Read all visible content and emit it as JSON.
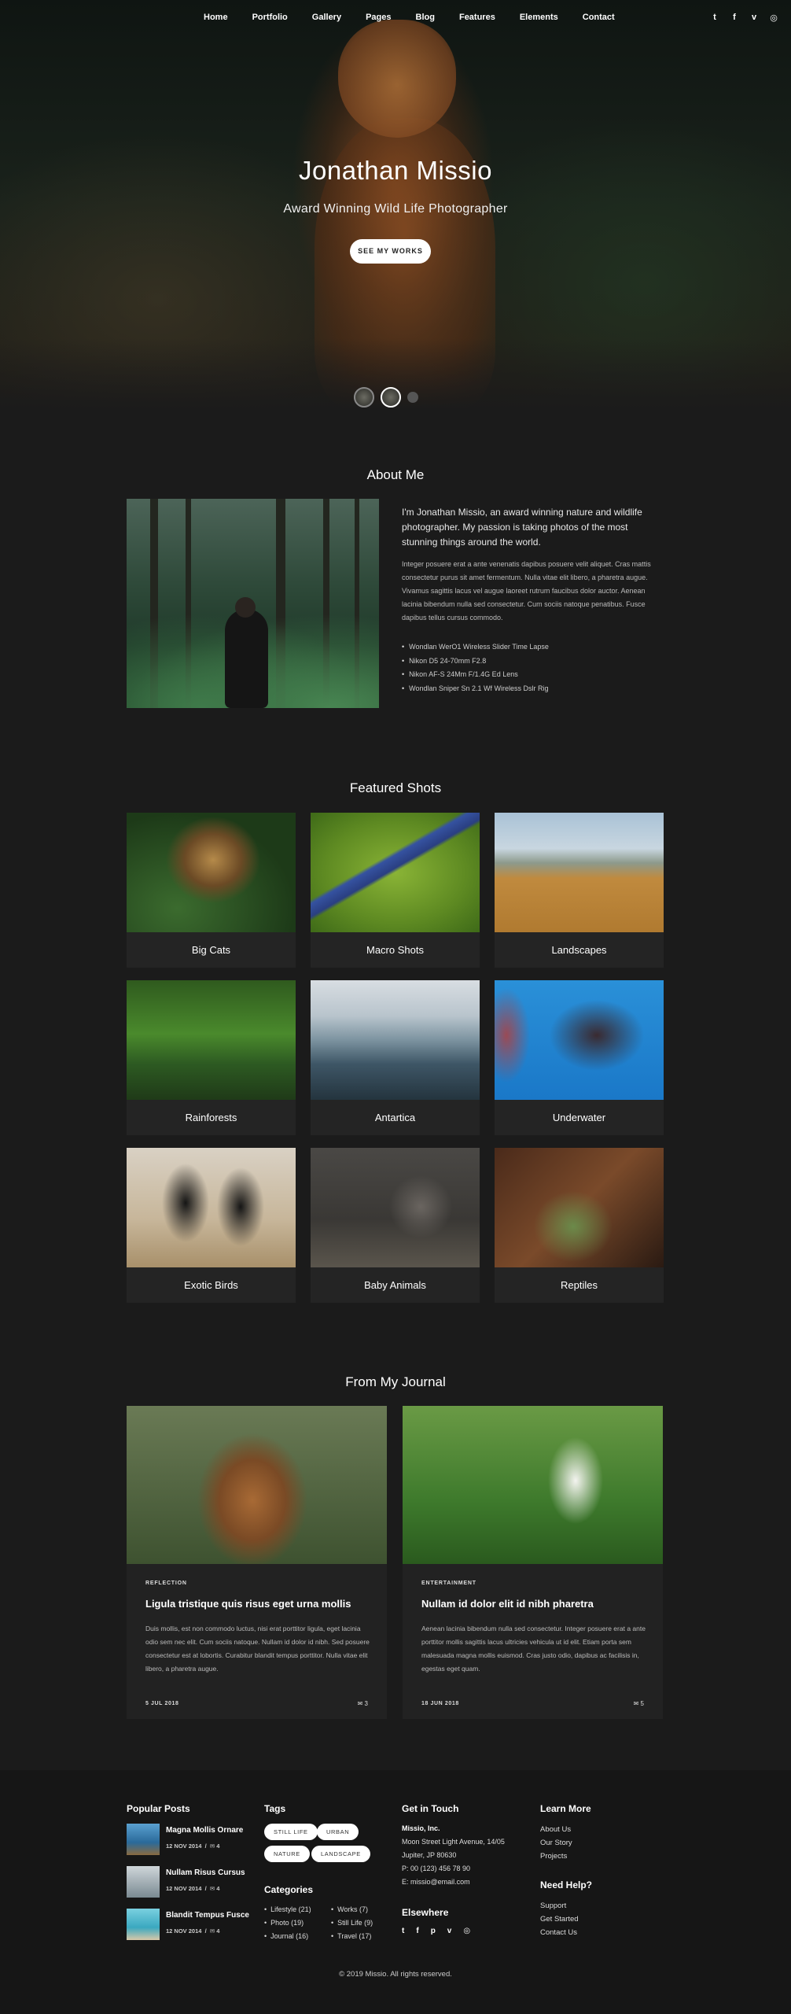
{
  "nav": {
    "links": [
      "Home",
      "Portfolio",
      "Gallery",
      "Pages",
      "Blog",
      "Features",
      "Elements",
      "Contact"
    ],
    "social": [
      "twitter-icon",
      "facebook-icon",
      "vimeo-icon",
      "instagram-icon"
    ],
    "social_glyphs": [
      "t",
      "f",
      "v",
      "◎"
    ]
  },
  "hero": {
    "title": "Jonathan Missio",
    "subtitle": "Award Winning Wild Life Photographer",
    "button": "SEE MY WORKS"
  },
  "about": {
    "heading": "About Me",
    "lead": "I'm Jonathan Missio, an award winning nature and wildlife photographer. My passion is taking photos of the most stunning things around the world.",
    "body": "Integer posuere erat a ante venenatis dapibus posuere velit aliquet. Cras mattis consectetur purus sit amet fermentum. Nulla vitae elit libero, a pharetra augue. Vivamus sagittis lacus vel augue laoreet rutrum faucibus dolor auctor. Aenean lacinia bibendum nulla sed consectetur. Cum sociis natoque penatibus. Fusce dapibus tellus cursus commodo.",
    "gear": [
      "Wondlan WerO1 Wireless Slider Time Lapse",
      "Nikon D5 24-70mm F2.8",
      "Nikon AF-S 24Mm F/1.4G Ed Lens",
      "Wondlan Sniper Sn 2.1 Wf Wireless Dslr Rig"
    ]
  },
  "featured": {
    "heading": "Featured Shots",
    "items": [
      "Big Cats",
      "Macro Shots",
      "Landscapes",
      "Rainforests",
      "Antartica",
      "Underwater",
      "Exotic Birds",
      "Baby Animals",
      "Reptiles"
    ]
  },
  "journal": {
    "heading": "From My Journal",
    "posts": [
      {
        "category": "REFLECTION",
        "title": "Ligula tristique quis risus eget urna mollis",
        "excerpt": "Duis mollis, est non commodo luctus, nisi erat porttitor ligula, eget lacinia odio sem nec elit. Cum sociis natoque. Nullam id dolor id nibh. Sed posuere consectetur est at lobortis. Curabitur blandit tempus porttitor. Nulla vitae elit libero, a pharetra augue.",
        "date": "5 JUL 2018",
        "comments": "3"
      },
      {
        "category": "ENTERTAINMENT",
        "title": "Nullam id dolor elit id nibh pharetra",
        "excerpt": "Aenean lacinia bibendum nulla sed consectetur. Integer posuere erat a ante porttitor mollis sagittis lacus ultricies vehicula ut id elit. Etiam porta sem malesuada magna mollis euismod. Cras justo odio, dapibus ac facilisis in, egestas eget quam.",
        "date": "18 JUN 2018",
        "comments": "5"
      }
    ]
  },
  "footer": {
    "popular_title": "Popular Posts",
    "popular": [
      {
        "title": "Magna Mollis Ornare",
        "date": "12 NOV 2014",
        "comments": "4"
      },
      {
        "title": "Nullam Risus Cursus",
        "date": "12 NOV 2014",
        "comments": "4"
      },
      {
        "title": "Blandit Tempus Fusce",
        "date": "12 NOV 2014",
        "comments": "4"
      }
    ],
    "tags_title": "Tags",
    "tags": [
      "STILL LIFE",
      "URBAN",
      "NATURE",
      "LANDSCAPE"
    ],
    "categories_title": "Categories",
    "categories_left": [
      "Lifestyle (21)",
      "Photo (19)",
      "Journal (16)"
    ],
    "categories_right": [
      "Works (7)",
      "Still Life (9)",
      "Travel (17)"
    ],
    "contact_title": "Get in Touch",
    "company": "Missio, Inc.",
    "address1": "Moon Street Light Avenue, 14/05",
    "address2": "Jupiter, JP 80630",
    "phone": "P: 00 (123) 456 78 90",
    "email": "E: missio@email.com",
    "elsewhere_title": "Elsewhere",
    "elsewhere_icons": [
      "twitter-icon",
      "facebook-icon",
      "pinterest-icon",
      "vimeo-icon",
      "instagram-icon"
    ],
    "elsewhere_glyphs": [
      "t",
      "f",
      "p",
      "v",
      "◎"
    ],
    "learn_title": "Learn More",
    "learn": [
      "About Us",
      "Our Story",
      "Projects"
    ],
    "help_title": "Need Help?",
    "help": [
      "Support",
      "Get Started",
      "Contact Us"
    ],
    "copyright": "© 2019 Missio. All rights reserved."
  }
}
